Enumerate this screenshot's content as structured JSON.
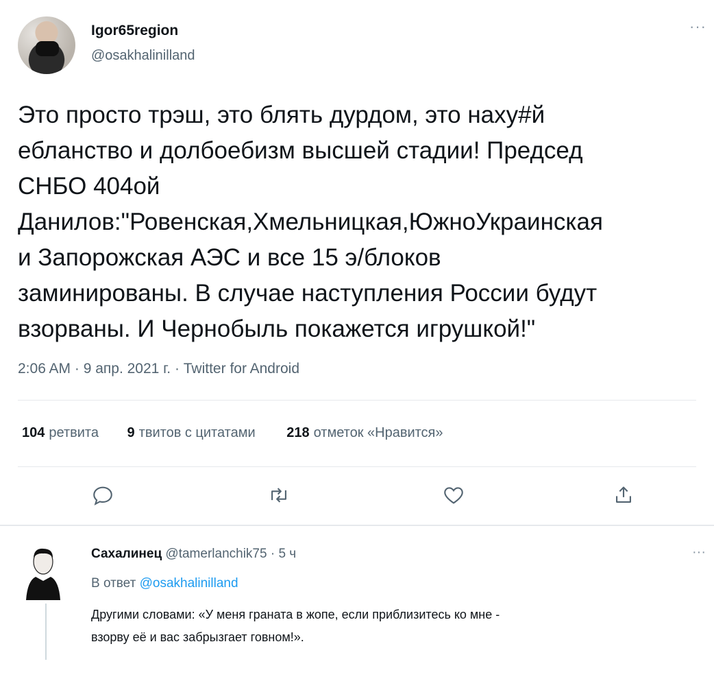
{
  "tweet": {
    "author_name": "Igor65region",
    "author_handle": "@osakhalinilland",
    "more": "···",
    "text_lines": [
      "Это просто трэш, это блять дурдом, это наху#й",
      "ебланство и долбоебизм высшей стадии! Председ",
      "СНБО 404ой",
      "Данилов:\"Ровенская,Хмельницкая,ЮжноУкраинская",
      "и Запорожская АЭС и все 15 э/блоков",
      "заминированы. В случае наступления России будут",
      "взорваны. И Чернобыль покажется игрушкой!\""
    ],
    "meta": "2:06 AM · 9 апр. 2021 г. · Twitter for Android"
  },
  "stats": {
    "retweets_count": "104",
    "retweets_label": "ретвита",
    "quotes_count": "9",
    "quotes_label": "твитов с цитатами",
    "likes_count": "218",
    "likes_label": "отметок «Нравится»"
  },
  "actions": {
    "icons": [
      "reply-icon",
      "retweet-icon",
      "like-icon",
      "share-icon"
    ],
    "icon_color": "#536471"
  },
  "reply": {
    "author_name": "Сахалинец",
    "author_handle": "@tamerlanchik75",
    "time": "· 5 ч",
    "more": "···",
    "reply_to_prefix": "В ответ",
    "reply_to_handle": "@osakhalinilland",
    "text_lines": [
      "Другими словами: «У меня граната в жопе, если приблизитесь ко мне -",
      "взорву её и вас забрызгает говном!»."
    ]
  },
  "colors": {
    "text": "#0f1419",
    "secondary": "#536471",
    "link": "#1d9bf0",
    "divider": "#e6e9ec"
  }
}
